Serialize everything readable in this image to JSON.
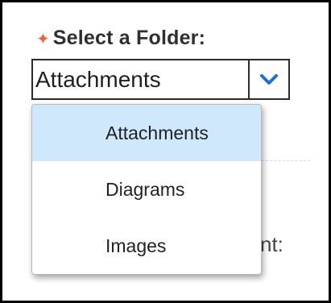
{
  "field": {
    "required_marker": "✦",
    "label": "Select a Folder:",
    "selected_value": "Attachments",
    "arrow_icon": "chevron-down-icon"
  },
  "dropdown": {
    "options": [
      {
        "label": "Attachments",
        "selected": true
      },
      {
        "label": "Diagrams",
        "selected": false
      },
      {
        "label": "Images",
        "selected": false
      }
    ]
  },
  "background": {
    "partial_label": "nt:"
  },
  "colors": {
    "required_marker": "#e8643c",
    "selected_option_bg": "#cfe8fc",
    "chevron": "#1f6fd0"
  }
}
